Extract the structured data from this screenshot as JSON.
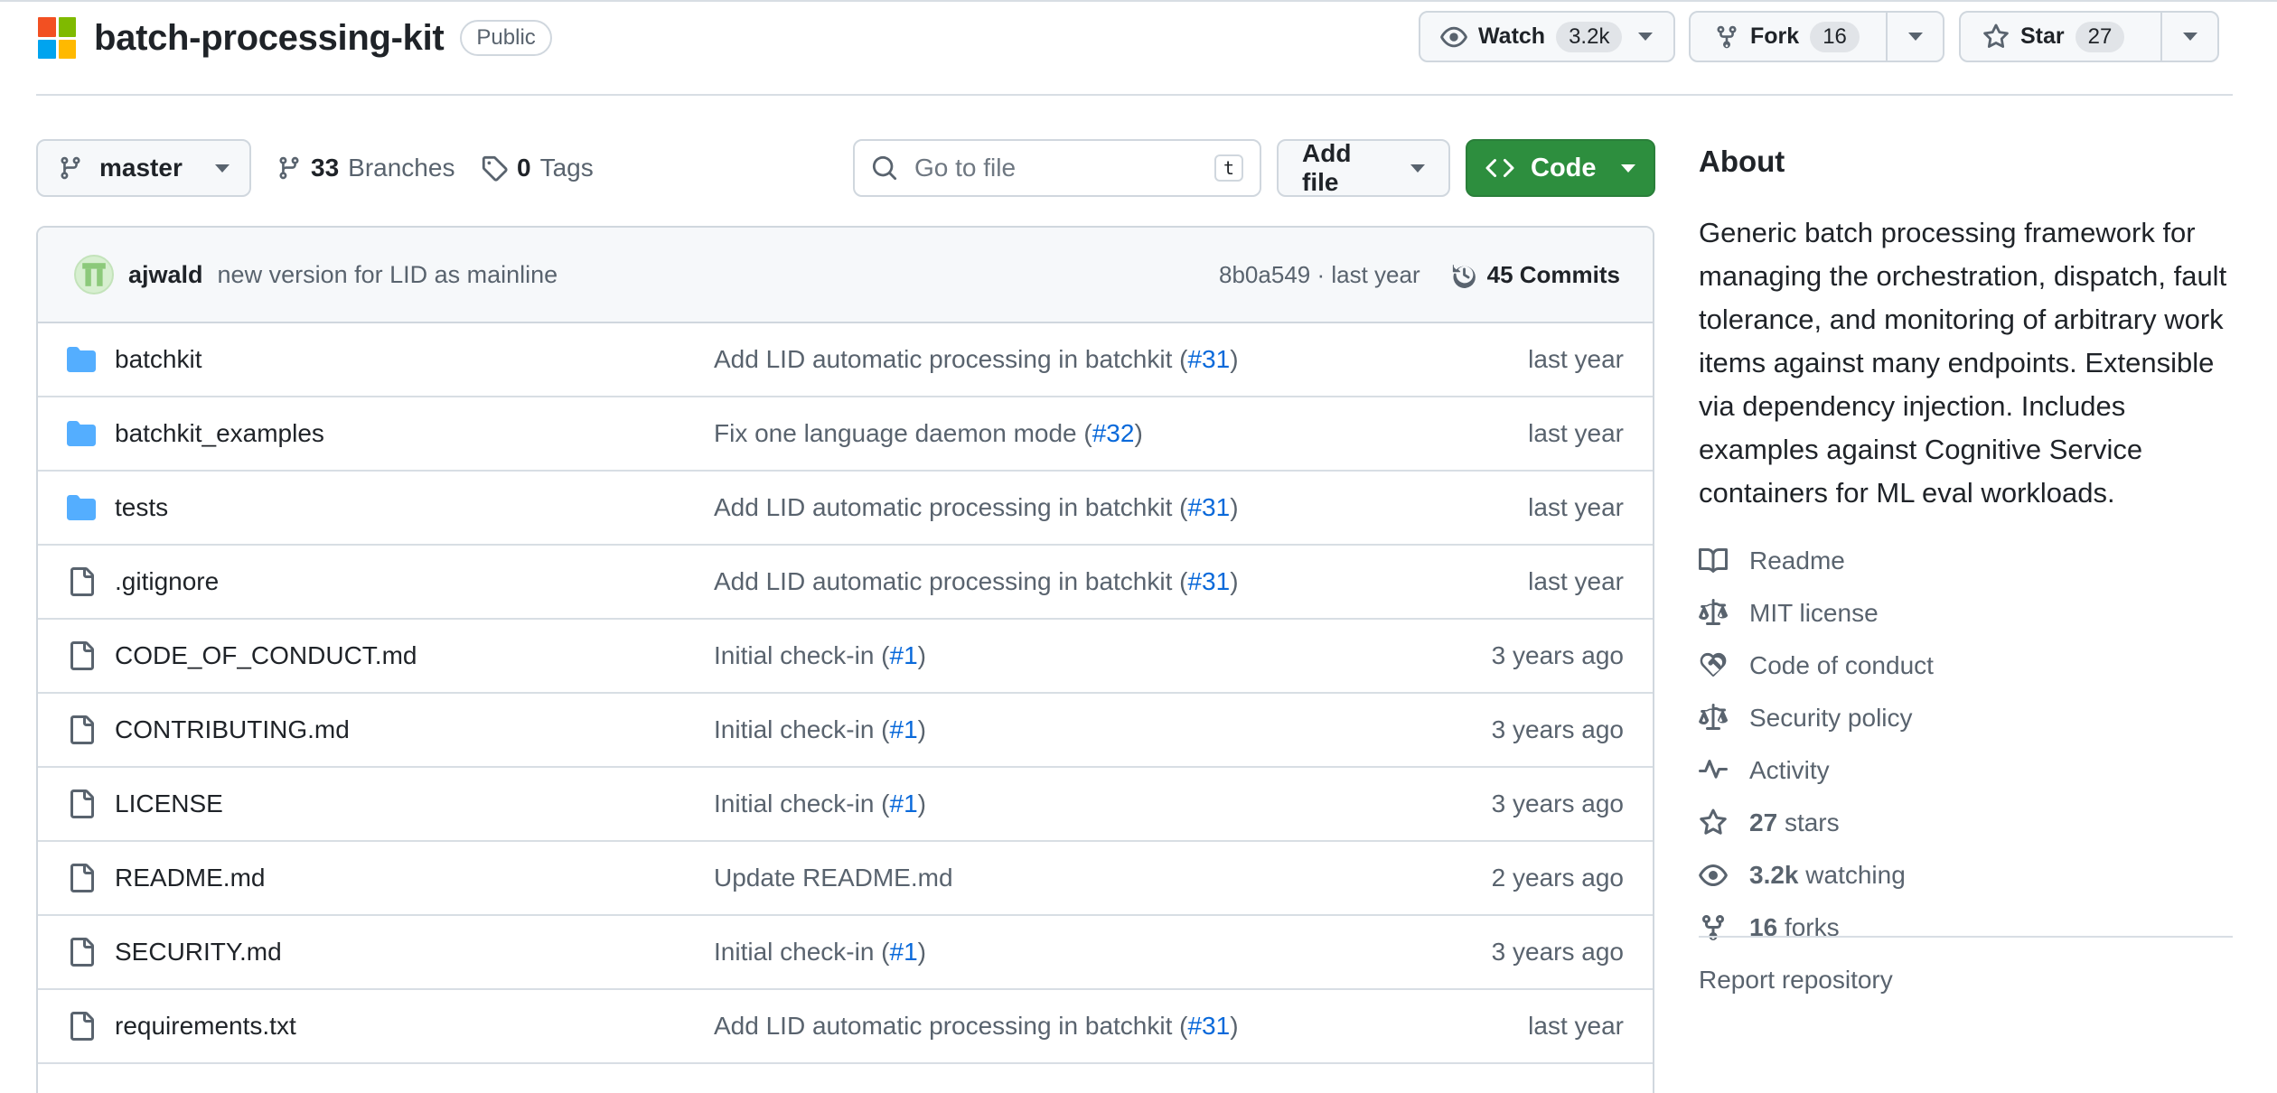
{
  "repo": {
    "name": "batch-processing-kit",
    "visibility": "Public",
    "logo_colors": [
      "#f25022",
      "#7fba00",
      "#00a4ef",
      "#ffb900"
    ]
  },
  "header_actions": {
    "watch": {
      "label": "Watch",
      "count": "3.2k"
    },
    "fork": {
      "label": "Fork",
      "count": "16"
    },
    "star": {
      "label": "Star",
      "count": "27"
    }
  },
  "toolbar": {
    "branch": "master",
    "branches_count": "33",
    "branches_label": "Branches",
    "tags_count": "0",
    "tags_label": "Tags",
    "goto_placeholder": "Go to file",
    "goto_shortcut": "t",
    "add_file": "Add file",
    "code": "Code",
    "code_color": "#2d8e3e"
  },
  "latest_commit": {
    "author": "ajwald",
    "message": "new version for LID as mainline",
    "hash_time": "8b0a549 · last year",
    "commits_label": "45 Commits"
  },
  "files": [
    {
      "type": "folder",
      "name": "batchkit",
      "msg": "Add LID automatic processing in batchkit (",
      "pr": "#31",
      "msg_end": ")",
      "date": "last year"
    },
    {
      "type": "folder",
      "name": "batchkit_examples",
      "msg": "Fix one language daemon mode (",
      "pr": "#32",
      "msg_end": ")",
      "date": "last year"
    },
    {
      "type": "folder",
      "name": "tests",
      "msg": "Add LID automatic processing in batchkit (",
      "pr": "#31",
      "msg_end": ")",
      "date": "last year"
    },
    {
      "type": "file",
      "name": ".gitignore",
      "msg": "Add LID automatic processing in batchkit (",
      "pr": "#31",
      "msg_end": ")",
      "date": "last year"
    },
    {
      "type": "file",
      "name": "CODE_OF_CONDUCT.md",
      "msg": "Initial check-in (",
      "pr": "#1",
      "msg_end": ")",
      "date": "3 years ago"
    },
    {
      "type": "file",
      "name": "CONTRIBUTING.md",
      "msg": "Initial check-in (",
      "pr": "#1",
      "msg_end": ")",
      "date": "3 years ago"
    },
    {
      "type": "file",
      "name": "LICENSE",
      "msg": "Initial check-in (",
      "pr": "#1",
      "msg_end": ")",
      "date": "3 years ago"
    },
    {
      "type": "file",
      "name": "README.md",
      "msg": "Update README.md",
      "pr": "",
      "msg_end": "",
      "date": "2 years ago"
    },
    {
      "type": "file",
      "name": "SECURITY.md",
      "msg": "Initial check-in (",
      "pr": "#1",
      "msg_end": ")",
      "date": "3 years ago"
    },
    {
      "type": "file",
      "name": "requirements.txt",
      "msg": "Add LID automatic processing in batchkit (",
      "pr": "#31",
      "msg_end": ")",
      "date": "last year"
    }
  ],
  "about": {
    "title": "About",
    "description": "Generic batch processing framework for managing the orchestration, dispatch, fault tolerance, and monitoring of arbitrary work items against many endpoints. Extensible via dependency injection. Includes examples against Cognitive Service containers for ML eval workloads.",
    "links": [
      {
        "icon": "book-icon",
        "label": "Readme"
      },
      {
        "icon": "law-icon",
        "label": "MIT license"
      },
      {
        "icon": "heart-handshake-icon",
        "label": "Code of conduct"
      },
      {
        "icon": "law-icon",
        "label": "Security policy"
      },
      {
        "icon": "pulse-icon",
        "label": "Activity"
      }
    ],
    "stats": [
      {
        "icon": "star-icon",
        "value": "27",
        "label": "stars"
      },
      {
        "icon": "eye-icon",
        "value": "3.2k",
        "label": "watching"
      },
      {
        "icon": "fork-icon",
        "value": "16",
        "label": "forks"
      }
    ],
    "report": "Report repository"
  }
}
